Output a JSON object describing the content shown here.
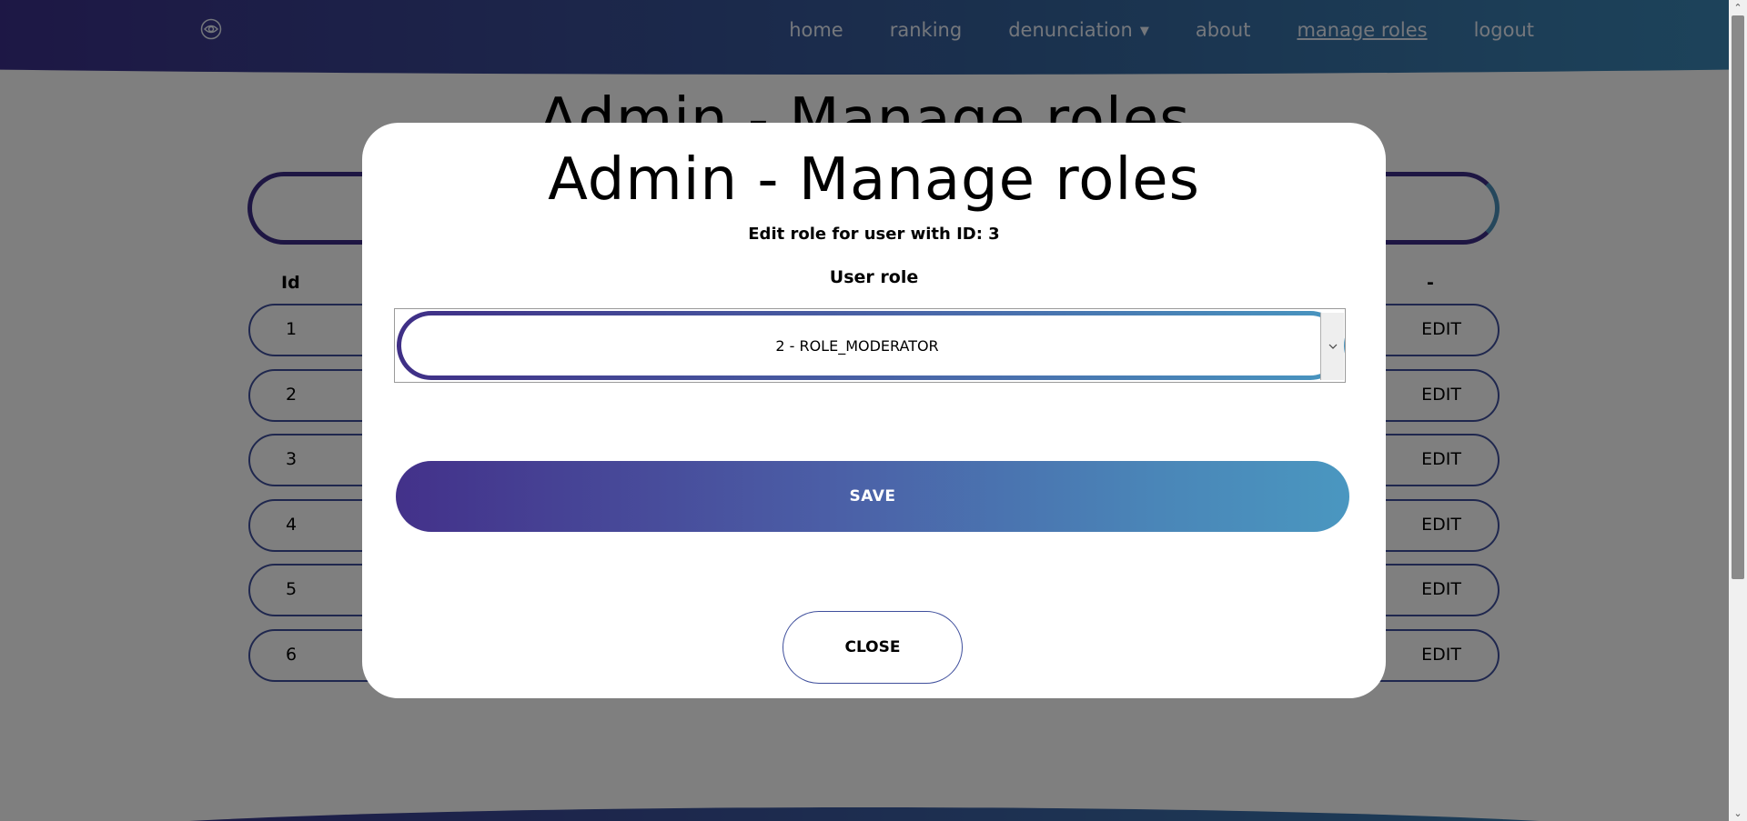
{
  "nav": {
    "logo_icon": "eye-icon",
    "links": [
      {
        "label": "home"
      },
      {
        "label": "ranking"
      },
      {
        "label": "denunciation"
      },
      {
        "label": "about"
      },
      {
        "label": "manage roles"
      },
      {
        "label": "logout"
      }
    ],
    "dropdown_caret": "▼"
  },
  "page": {
    "title": "Admin - Manage roles",
    "table": {
      "headers": {
        "id": "Id",
        "action": "-"
      },
      "rows": [
        {
          "id": "1",
          "action": "EDIT"
        },
        {
          "id": "2",
          "action": "EDIT"
        },
        {
          "id": "3",
          "action": "EDIT"
        },
        {
          "id": "4",
          "action": "EDIT"
        },
        {
          "id": "5",
          "action": "EDIT"
        },
        {
          "id": "6",
          "action": "EDIT"
        }
      ]
    }
  },
  "modal": {
    "title": "Admin - Manage roles",
    "subtitle": "Edit role for user with ID: 3",
    "role_label": "User role",
    "selected_role": "2 - ROLE_MODERATOR",
    "save_label": "SAVE",
    "close_label": "CLOSE"
  },
  "colors": {
    "gradient_start": "#3f2f86",
    "gradient_end": "#4896c0",
    "overlay": "rgba(0,0,0,0.5)"
  }
}
